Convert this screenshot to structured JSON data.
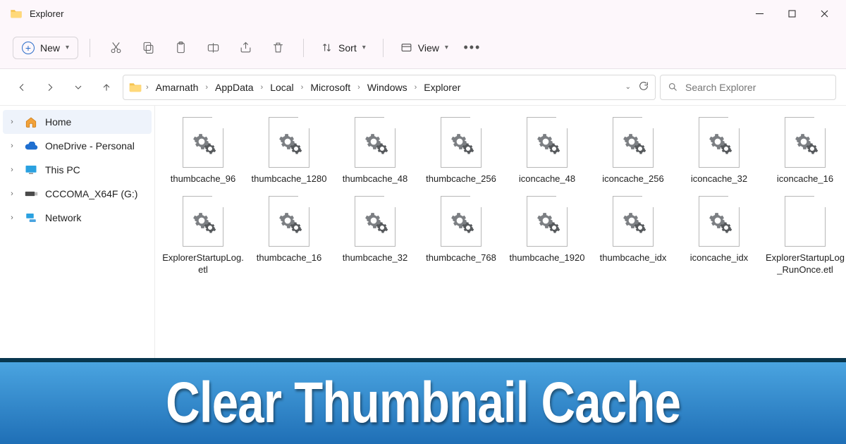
{
  "title": "Explorer",
  "toolbar": {
    "new_label": "New",
    "sort_label": "Sort",
    "view_label": "View"
  },
  "breadcrumbs": [
    "Amarnath",
    "AppData",
    "Local",
    "Microsoft",
    "Windows",
    "Explorer"
  ],
  "search": {
    "placeholder": "Search Explorer"
  },
  "sidebar": {
    "items": [
      {
        "label": "Home"
      },
      {
        "label": "OneDrive - Personal"
      },
      {
        "label": "This PC"
      },
      {
        "label": "CCCOMA_X64F (G:)"
      },
      {
        "label": "Network"
      }
    ]
  },
  "files": [
    {
      "name": "thumbcache_96",
      "blank": false
    },
    {
      "name": "thumbcache_1280",
      "blank": false
    },
    {
      "name": "thumbcache_48",
      "blank": false
    },
    {
      "name": "thumbcache_256",
      "blank": false
    },
    {
      "name": "iconcache_48",
      "blank": false
    },
    {
      "name": "iconcache_256",
      "blank": false
    },
    {
      "name": "iconcache_32",
      "blank": false
    },
    {
      "name": "iconcache_16",
      "blank": false
    },
    {
      "name": "ExplorerStartupLog.etl",
      "blank": false
    },
    {
      "name": "thumbcache_16",
      "blank": false
    },
    {
      "name": "thumbcache_32",
      "blank": false
    },
    {
      "name": "thumbcache_768",
      "blank": false
    },
    {
      "name": "thumbcache_1920",
      "blank": false
    },
    {
      "name": "thumbcache_idx",
      "blank": false
    },
    {
      "name": "iconcache_idx",
      "blank": false
    },
    {
      "name": "ExplorerStartupLog_RunOnce.etl",
      "blank": true
    }
  ],
  "banner": {
    "text": "Clear Thumbnail Cache"
  }
}
